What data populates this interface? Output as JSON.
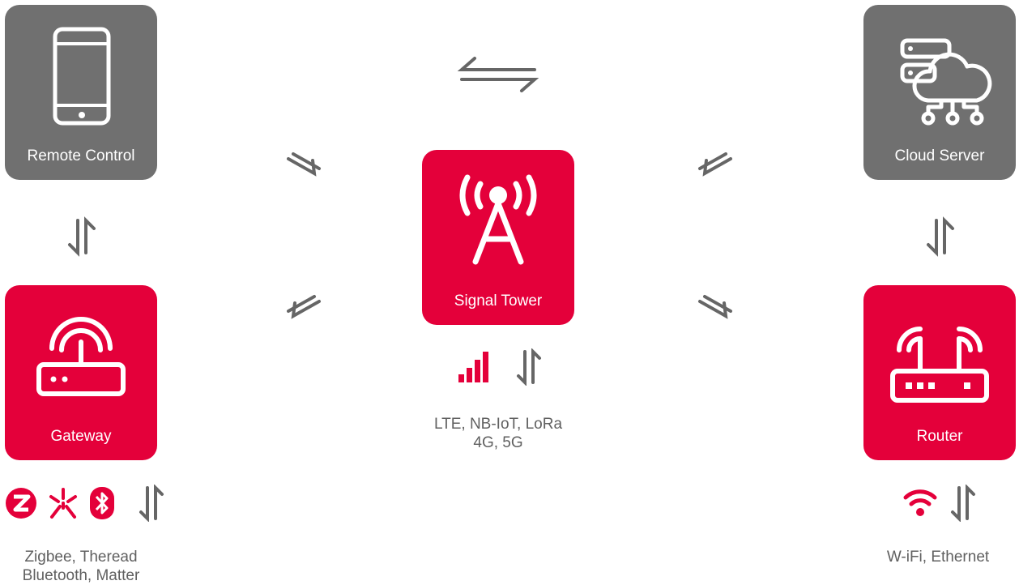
{
  "colors": {
    "accent": "#e4003a",
    "neutral": "#707070",
    "arrow": "#666666",
    "text": "#606060"
  },
  "nodes": {
    "remote_control": {
      "label": "Remote Control",
      "icon": "smartphone-icon"
    },
    "cloud_server": {
      "label": "Cloud Server",
      "icon": "cloud-server-icon"
    },
    "signal_tower": {
      "label": "Signal Tower",
      "icon": "signal-tower-icon"
    },
    "gateway": {
      "label": "Gateway",
      "icon": "gateway-icon"
    },
    "router": {
      "label": "Router",
      "icon": "router-icon"
    }
  },
  "captions": {
    "tower": {
      "line1": "LTE, NB-IoT, LoRa",
      "line2": "4G, 5G"
    },
    "gateway": {
      "line1": "Zigbee, Theread",
      "line2": "Bluetooth, Matter"
    },
    "router": {
      "line1": "W-iFi, Ethernet"
    }
  },
  "protocol_icons": {
    "tower": [
      "cellular-signal-icon"
    ],
    "gateway": [
      "zigbee-icon",
      "thread-icon",
      "bluetooth-icon"
    ],
    "router": [
      "wifi-icon"
    ]
  }
}
